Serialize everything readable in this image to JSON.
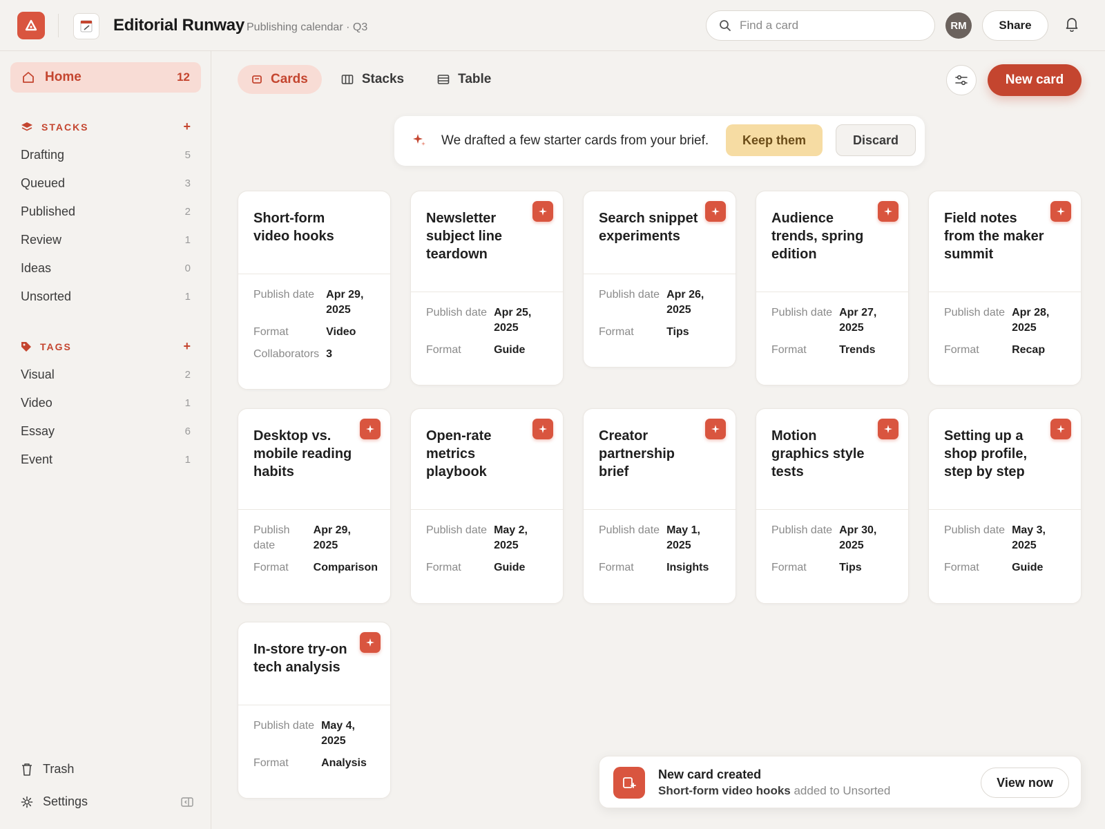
{
  "app": {
    "title": "Editorial Runway",
    "subtitle": "Publishing calendar · Q3",
    "accent": "#c4452f"
  },
  "topbar": {
    "search_placeholder": "Find a card",
    "avatar_initials": "RM",
    "share_label": "Share"
  },
  "sidebar": {
    "home": {
      "label": "Home",
      "count": "12"
    },
    "stacks_heading": "STACKS",
    "stacks": [
      {
        "label": "Drafting",
        "count": "5"
      },
      {
        "label": "Queued",
        "count": "3"
      },
      {
        "label": "Published",
        "count": "2"
      },
      {
        "label": "Review",
        "count": "1"
      },
      {
        "label": "Ideas",
        "count": "0"
      },
      {
        "label": "Unsorted",
        "count": "1"
      }
    ],
    "tags_heading": "TAGS",
    "tags": [
      {
        "label": "Visual",
        "count": "2"
      },
      {
        "label": "Video",
        "count": "1"
      },
      {
        "label": "Essay",
        "count": "6"
      },
      {
        "label": "Event",
        "count": "1"
      }
    ],
    "trash_label": "Trash",
    "settings_label": "Settings"
  },
  "views": [
    {
      "label": "Cards",
      "icon": "card-icon"
    },
    {
      "label": "Stacks",
      "icon": "columns-icon"
    },
    {
      "label": "Table",
      "icon": "table-icon"
    }
  ],
  "toolbar": {
    "new_card_label": "New card"
  },
  "banner": {
    "message": "We drafted a few starter cards from your brief.",
    "keep_label": "Keep them",
    "discard_label": "Discard"
  },
  "meta_labels": {
    "publish_date": "Publish date",
    "format": "Format",
    "collaborators": "Collaborators"
  },
  "cards": [
    {
      "title": "Short-form video hooks",
      "date": "Apr 29, 2025",
      "format": "Video",
      "collaborators": "3",
      "ai": false
    },
    {
      "title": "Newsletter subject line teardown",
      "date": "Apr 25, 2025",
      "format": "Guide",
      "ai": true
    },
    {
      "title": "Search snippet experiments",
      "date": "Apr 26, 2025",
      "format": "Tips",
      "ai": true
    },
    {
      "title": "Audience trends, spring edition",
      "date": "Apr 27, 2025",
      "format": "Trends",
      "ai": true
    },
    {
      "title": "Field notes from the maker summit",
      "date": "Apr 28, 2025",
      "format": "Recap",
      "ai": true
    },
    {
      "title": "Desktop vs. mobile reading habits",
      "date": "Apr 29, 2025",
      "format": "Comparison",
      "ai": true
    },
    {
      "title": "Open-rate metrics playbook",
      "date": "May 2, 2025",
      "format": "Guide",
      "ai": true
    },
    {
      "title": "Creator partnership brief",
      "date": "May 1, 2025",
      "format": "Insights",
      "ai": true
    },
    {
      "title": "Motion graphics style tests",
      "date": "Apr 30, 2025",
      "format": "Tips",
      "ai": true
    },
    {
      "title": "Setting up a shop profile, step by step",
      "date": "May 3, 2025",
      "format": "Guide",
      "ai": true
    },
    {
      "title": "In-store try-on tech analysis",
      "date": "May 4, 2025",
      "format": "Analysis",
      "ai": true
    }
  ],
  "toast": {
    "title": "New card created",
    "card_name": "Short-form video hooks",
    "suffix": "added to Unsorted",
    "action_label": "View now"
  }
}
